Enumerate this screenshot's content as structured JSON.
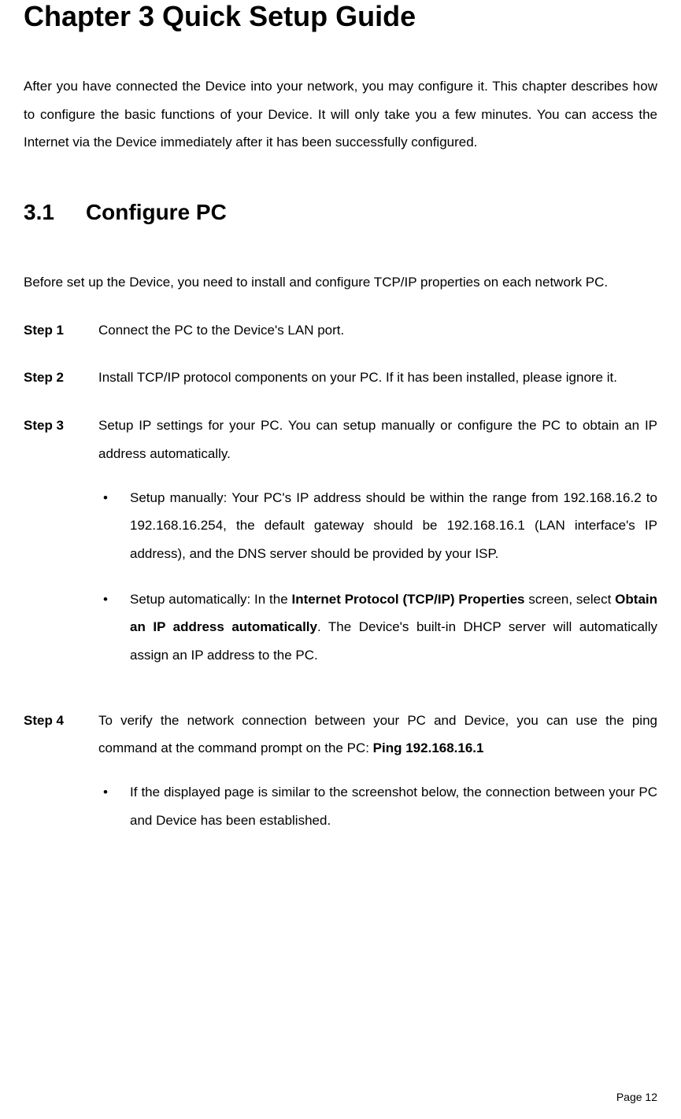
{
  "chapter_title": "Chapter 3 Quick Setup Guide",
  "intro": "After you have connected the Device into your network, you may configure it. This chapter describes how to configure the basic functions of your Device. It will only take you a few minutes. You can access the Internet via the Device immediately after it has been successfully configured.",
  "section": {
    "number": "3.1",
    "title": "Configure PC",
    "intro": "Before set up the Device, you need to install and configure TCP/IP properties on each network PC."
  },
  "steps": {
    "step1": {
      "label": "Step 1",
      "text": "Connect the PC to the Device's LAN port."
    },
    "step2": {
      "label": "Step 2",
      "text": "Install TCP/IP protocol components on your PC. If it has been installed, please ignore it."
    },
    "step3": {
      "label": "Step 3",
      "text": "Setup IP settings for your PC. You can setup manually or configure the PC to obtain an IP address automatically.",
      "bullets": {
        "b1": "Setup manually: Your PC's IP address should be within the range from 192.168.16.2 to 192.168.16.254, the default gateway should be 192.168.16.1 (LAN interface's IP address), and the DNS server should be provided by your ISP.",
        "b2_pre": "Setup automatically: In the ",
        "b2_bold1": "Internet Protocol (TCP/IP) Properties",
        "b2_mid": " screen, select ",
        "b2_bold2": "Obtain an IP address automatically",
        "b2_post": ". The Device's built-in DHCP server will automatically assign an IP address to the PC."
      }
    },
    "step4": {
      "label": "Step 4",
      "text_pre": "To verify the network connection between your PC and Device, you can use the ping command at the command prompt on the PC: ",
      "text_bold": "Ping 192.168.16.1",
      "bullets": {
        "b1": "If the displayed page is similar to the screenshot below, the connection between your PC and Device has been established."
      }
    }
  },
  "footer": "Page 12"
}
